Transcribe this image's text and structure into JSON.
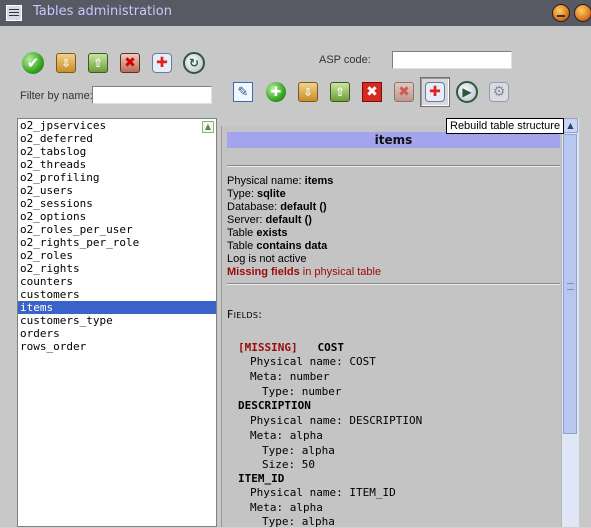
{
  "window": {
    "title": "Tables administration",
    "icon": "table-admin-icon"
  },
  "toolbar_left": {
    "buttons": [
      {
        "icon": "check-icon",
        "glyph": "✔"
      },
      {
        "icon": "export-disk-icon",
        "glyph": "⇩"
      },
      {
        "icon": "import-disk-icon",
        "glyph": "⇧"
      },
      {
        "icon": "delete-disk-icon",
        "glyph": "✖"
      },
      {
        "icon": "repair-icon",
        "glyph": "✚"
      },
      {
        "icon": "refresh-clock-icon",
        "glyph": "↻"
      }
    ]
  },
  "asp_code": {
    "label": "ASP code:",
    "value": ""
  },
  "filter": {
    "label": "Filter by name:",
    "value": ""
  },
  "toolbar_right": {
    "buttons": [
      {
        "icon": "edit-icon",
        "glyph": "✎"
      },
      {
        "icon": "add-icon",
        "glyph": "✚"
      },
      {
        "icon": "export-icon",
        "glyph": "⇩"
      },
      {
        "icon": "import-icon",
        "glyph": "⇧"
      },
      {
        "icon": "delete-icon",
        "glyph": "✖"
      },
      {
        "icon": "drop-icon",
        "glyph": "✖"
      },
      {
        "icon": "rebuild-table-icon",
        "glyph": "✚"
      },
      {
        "icon": "run-icon",
        "glyph": "▶"
      },
      {
        "icon": "settings-icon",
        "glyph": "⚙"
      }
    ],
    "tooltip": "Rebuild table structure"
  },
  "tables": [
    "o2_jpservices",
    "o2_deferred",
    "o2_tabslog",
    "o2_threads",
    "o2_profiling",
    "o2_users",
    "o2_sessions",
    "o2_options",
    "o2_roles_per_user",
    "o2_rights_per_role",
    "o2_roles",
    "o2_rights",
    "counters",
    "customers",
    "items",
    "customers_type",
    "orders",
    "rows_order"
  ],
  "selected_table": "items",
  "detail": {
    "header": "items",
    "physical_name_label": "Physical name: ",
    "physical_name": "items",
    "type_label": "Type: ",
    "type": "sqlite",
    "database_label": "Database: ",
    "database": "default ()",
    "server_label": "Server: ",
    "server": "default ()",
    "table_label": "Table ",
    "table_status": "exists",
    "data_label": "Table ",
    "data_status": "contains data",
    "log_status": "Log is not active",
    "missing_bold": "Missing fields",
    "missing_rest": " in physical table",
    "fields_heading": "Fields:",
    "missing_tag": "[MISSING]",
    "fields": [
      {
        "name": "COST",
        "physical_label": "Physical name: ",
        "physical": "COST",
        "meta_label": "Meta: ",
        "meta": "number",
        "type_label": "Type: ",
        "type": "number"
      },
      {
        "name": "DESCRIPTION",
        "physical_label": "Physical name: ",
        "physical": "DESCRIPTION",
        "meta_label": "Meta: ",
        "meta": "alpha",
        "type_label": "Type: ",
        "type": "alpha",
        "size_label": "Size: ",
        "size": "50"
      },
      {
        "name": "ITEM_ID",
        "physical_label": "Physical name: ",
        "physical": "ITEM_ID",
        "meta_label": "Meta: ",
        "meta": "alpha",
        "type_label": "Type: ",
        "type": "alpha"
      }
    ]
  },
  "colors": {
    "title_bg": "#575a63",
    "title_text": "#c8c8ff",
    "selection": "#3a63c9",
    "header_bg": "#a3a3ee",
    "missing_red": "#9b0a0a"
  }
}
